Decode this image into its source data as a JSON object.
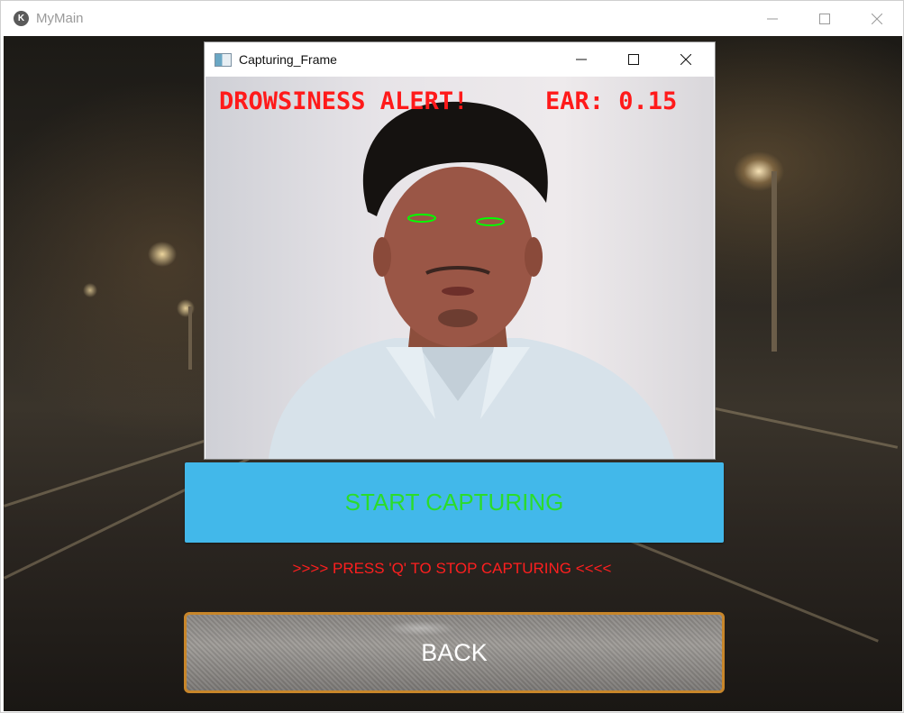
{
  "main_window": {
    "title": "MyMain",
    "logo_glyph": "K"
  },
  "capture_window": {
    "title": "Capturing_Frame",
    "overlay": {
      "alert_text": "DROWSINESS ALERT!",
      "ear_text": "EAR: 0.15",
      "overlay_color": "#ff1a1a",
      "eye_contour_color": "#00ff00"
    }
  },
  "controls": {
    "start_label": "START CAPTURING",
    "hint": ">>>> PRESS 'Q' TO STOP CAPTURING <<<<",
    "back_label": "BACK"
  },
  "colors": {
    "start_button_bg": "#42b8ea",
    "start_button_text": "#2bdc2b",
    "hint_text": "#ff1f1f",
    "back_border": "#c8862a"
  },
  "icons": {
    "window_controls": [
      "minimize-icon",
      "maximize-icon",
      "close-icon"
    ],
    "capture_window_icon": "image-frame-icon"
  }
}
